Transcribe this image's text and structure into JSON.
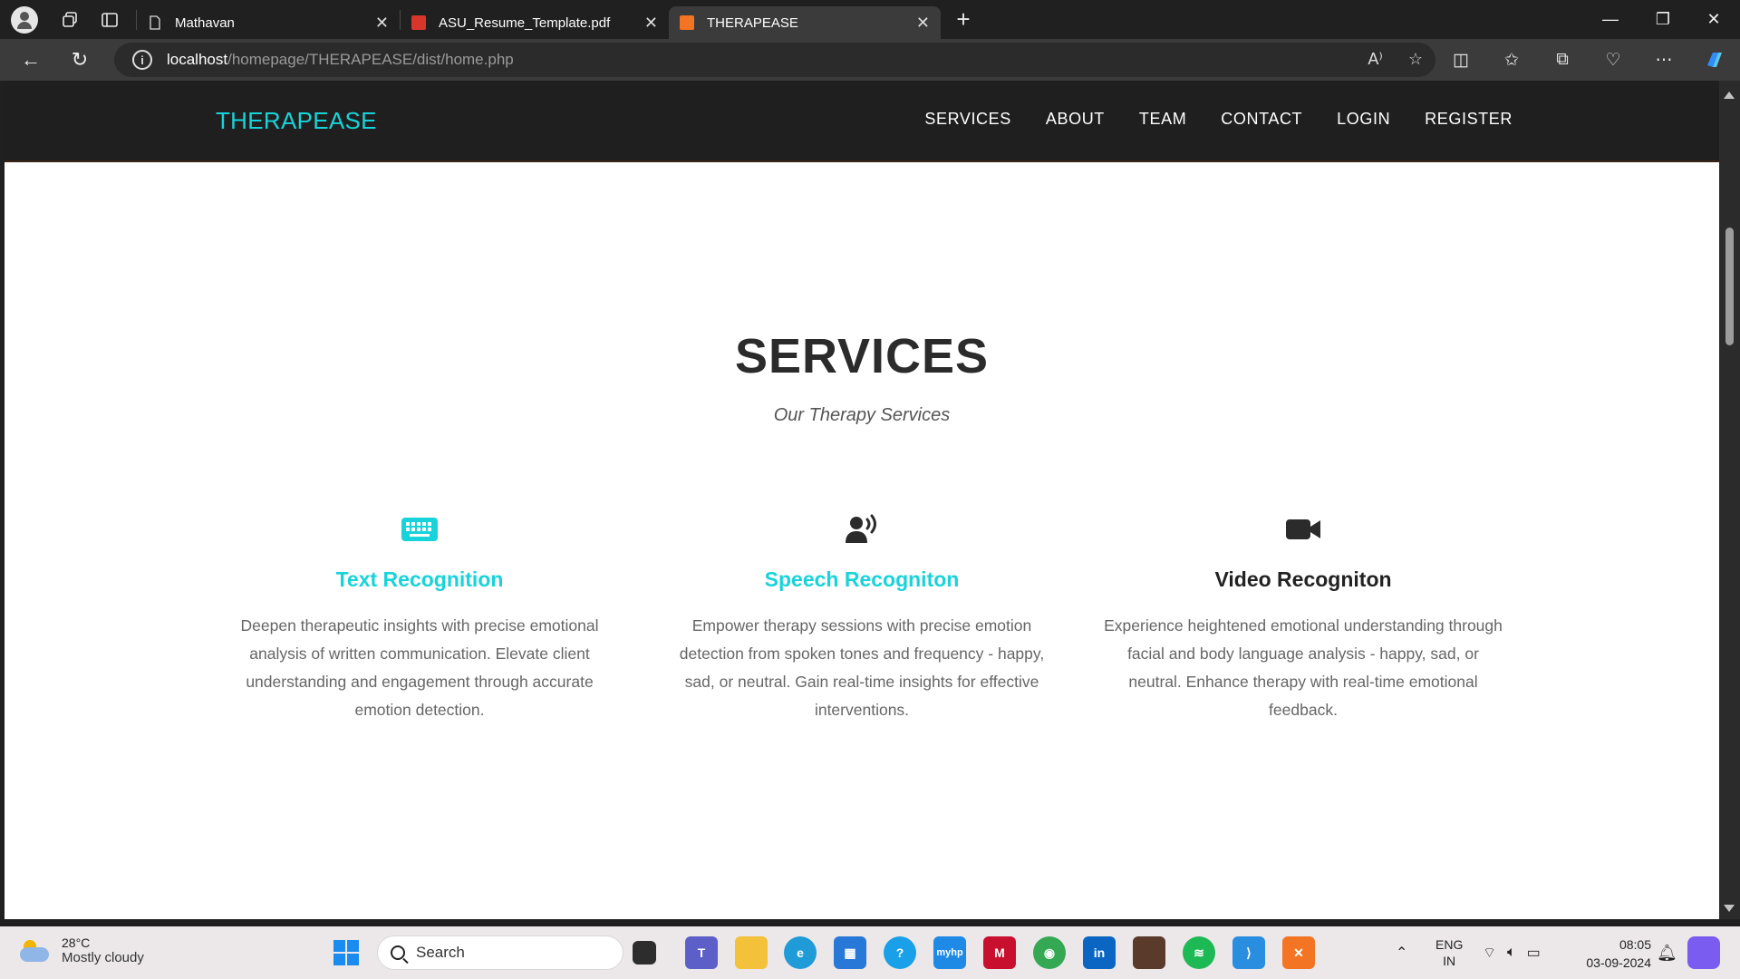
{
  "browser": {
    "tabs": [
      {
        "title": "Mathavan",
        "active": false
      },
      {
        "title": "ASU_Resume_Template.pdf",
        "active": false
      },
      {
        "title": "THERAPEASE",
        "active": true
      }
    ],
    "url_host": "localhost",
    "url_path": "/homepage/THERAPEASE/dist/home.php"
  },
  "site": {
    "logo": "THERAPEASE",
    "menu": [
      "SERVICES",
      "ABOUT",
      "TEAM",
      "CONTACT",
      "LOGIN",
      "REGISTER"
    ],
    "section_title": "SERVICES",
    "section_subtitle": "Our Therapy Services",
    "services": [
      {
        "title": "Text Recognition",
        "description": "Deepen therapeutic insights with precise emotional analysis of written communication. Elevate client understanding and engagement through accurate emotion detection.",
        "icon": "keyboard-icon",
        "color": "#19d3da"
      },
      {
        "title": "Speech Recogniton",
        "description": "Empower therapy sessions with precise emotion detection from spoken tones and frequency - happy, sad, or neutral. Gain real-time insights for effective interventions.",
        "icon": "speaking-person-icon",
        "color": "#19d3da"
      },
      {
        "title": "Video Recogniton",
        "description": "Experience heightened emotional understanding through facial and body language analysis - happy, sad, or neutral. Enhance therapy with real-time emotional feedback.",
        "icon": "video-camera-icon",
        "color": "#222222"
      }
    ]
  },
  "taskbar": {
    "weather_temp": "28°C",
    "weather_desc": "Mostly cloudy",
    "search_placeholder": "Search",
    "lang_1": "ENG",
    "lang_2": "IN",
    "time": "08:05",
    "date": "03-09-2024"
  }
}
